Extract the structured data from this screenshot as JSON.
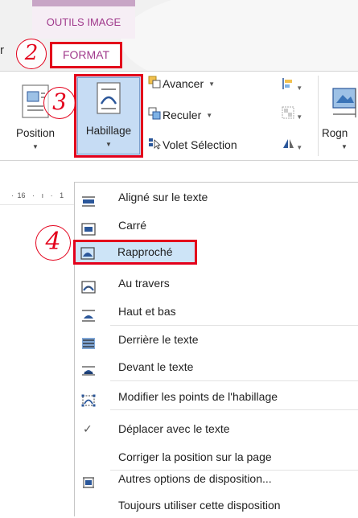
{
  "tabs": {
    "context_label": "OUTILS IMAGE",
    "left_partial": "r",
    "format": "FORMAT"
  },
  "annotations": {
    "step_2": "2",
    "step_3": "3",
    "step_4": "4"
  },
  "ribbon": {
    "position_label": "Position",
    "wrap_label": "Habillage",
    "bring_forward": "Avancer",
    "send_backward": "Reculer",
    "selection_pane": "Volet Sélection",
    "crop_label": "Rogn"
  },
  "ruler": {
    "mark_16": "16",
    "mark_1": "1"
  },
  "menu": {
    "items": [
      {
        "label": "Aligné sur le texte",
        "icon": "inline-wrap-icon"
      },
      {
        "label": "Carré",
        "icon": "square-wrap-icon"
      },
      {
        "label": "Rapproché",
        "icon": "tight-wrap-icon"
      },
      {
        "label": "Au travers",
        "icon": "through-wrap-icon"
      },
      {
        "label": "Haut et bas",
        "icon": "top-bottom-wrap-icon"
      },
      {
        "label": "Derrière le texte",
        "icon": "behind-text-icon"
      },
      {
        "label": "Devant le texte",
        "icon": "in-front-text-icon"
      },
      {
        "label": "Modifier les points de l'habillage",
        "icon": "edit-wrap-points-icon"
      },
      {
        "label": "Déplacer avec le texte",
        "icon": "check-icon"
      },
      {
        "label": "Corriger la position sur la page",
        "icon": ""
      },
      {
        "label": "Autres options de disposition...",
        "icon": "layout-options-icon"
      },
      {
        "label": "Toujours utiliser cette disposition",
        "icon": ""
      }
    ]
  },
  "colors": {
    "annotation_red": "#e3001b",
    "context_purple": "#a03a8c",
    "hover_blue": "#cde4f7",
    "icon_blue": "#2b579a"
  }
}
